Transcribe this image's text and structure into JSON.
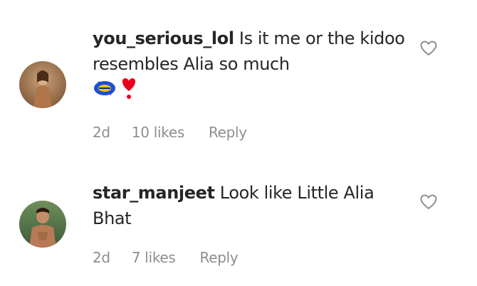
{
  "comments": [
    {
      "username": "you_serious_lol",
      "text": "Is it me or the kidoo resembles Alia so much",
      "emoji": [
        "rotating-arrows-emoji",
        "red-heart-exclamation-emoji"
      ],
      "time": "2d",
      "likes": "10 likes",
      "reply_label": "Reply",
      "like_icon": "heart-outline-icon"
    },
    {
      "username": "star_manjeet",
      "text": "Look like Little Alia Bhat",
      "time": "2d",
      "likes": "7 likes",
      "reply_label": "Reply",
      "like_icon": "heart-outline-icon"
    }
  ],
  "colors": {
    "primary_text": "#262626",
    "secondary_text": "#8e8e8e",
    "heart_stroke": "#8e8e8e",
    "emoji_heart": "#e8001c",
    "emoji_arrows_blue": "#1d4fd6",
    "emoji_arrows_yellow": "#f4c20d"
  }
}
